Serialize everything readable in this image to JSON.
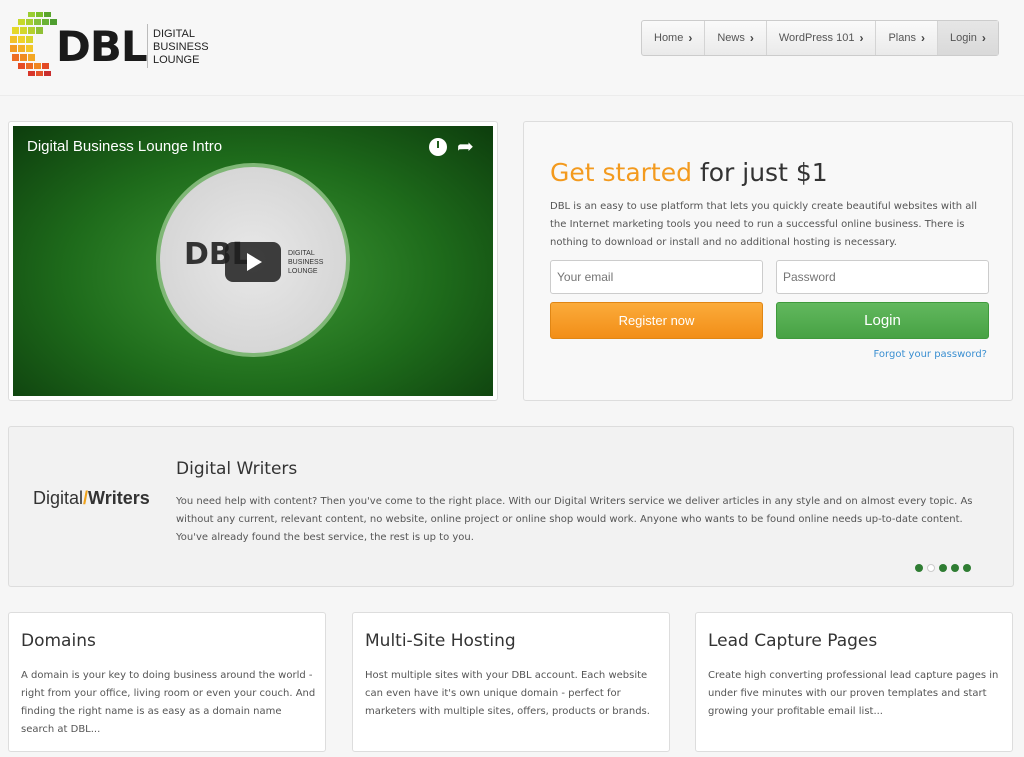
{
  "brand": {
    "logo_text": "DBL",
    "sub_lines": [
      "DIGITAL",
      "BUSINESS",
      "LOUNGE"
    ]
  },
  "nav": {
    "items": [
      {
        "label": "Home"
      },
      {
        "label": "News"
      },
      {
        "label": "WordPress 101"
      },
      {
        "label": "Plans"
      },
      {
        "label": "Login"
      }
    ]
  },
  "video": {
    "title": "Digital Business Lounge Intro",
    "thumb_logo": "DBL",
    "thumb_sub_lines": [
      "DIGITAL",
      "BUSINESS",
      "LOUNGE"
    ]
  },
  "register": {
    "title_highlight": "Get started",
    "title_rest": "for just $1",
    "description": "DBL is an easy to use platform that lets you quickly create beautiful websites with all the Internet marketing tools you need to run a successful online business. There is nothing to download or install and no additional hosting is necessary.",
    "email_placeholder": "Your email",
    "password_placeholder": "Password",
    "register_label": "Register now",
    "login_label": "Login",
    "forgot_label": "Forgot your password?"
  },
  "digital_writers": {
    "logo_left": "Digital",
    "logo_slash": "/",
    "logo_right": "Writers",
    "title": "Digital Writers",
    "text": "You need help with content? Then you've come to the right place. With our Digital Writers service we deliver articles in any style and on almost every topic. As without any current, relevant content, no website, online project or online shop would work. Anyone who wants to be found online needs up-to-date content. You've already found the best service, the rest is up to you."
  },
  "features": [
    {
      "title": "Domains",
      "text": "A domain is your key to doing business around the world - right from your office, living room or even your couch. And finding the right name is as easy as a domain name search at DBL..."
    },
    {
      "title": "Multi-Site Hosting",
      "text": "Host multiple sites with your DBL account. Each website can even have it's own unique domain - perfect for marketers with multiple sites, offers, products or brands."
    },
    {
      "title": "Lead Capture Pages",
      "text": "Create high converting professional lead capture pages in under five minutes with our proven templates and start growing your profitable email list..."
    }
  ],
  "colors": {
    "accent_orange": "#f39a1e",
    "accent_green": "#47a244",
    "link_blue": "#3a8fd1"
  }
}
